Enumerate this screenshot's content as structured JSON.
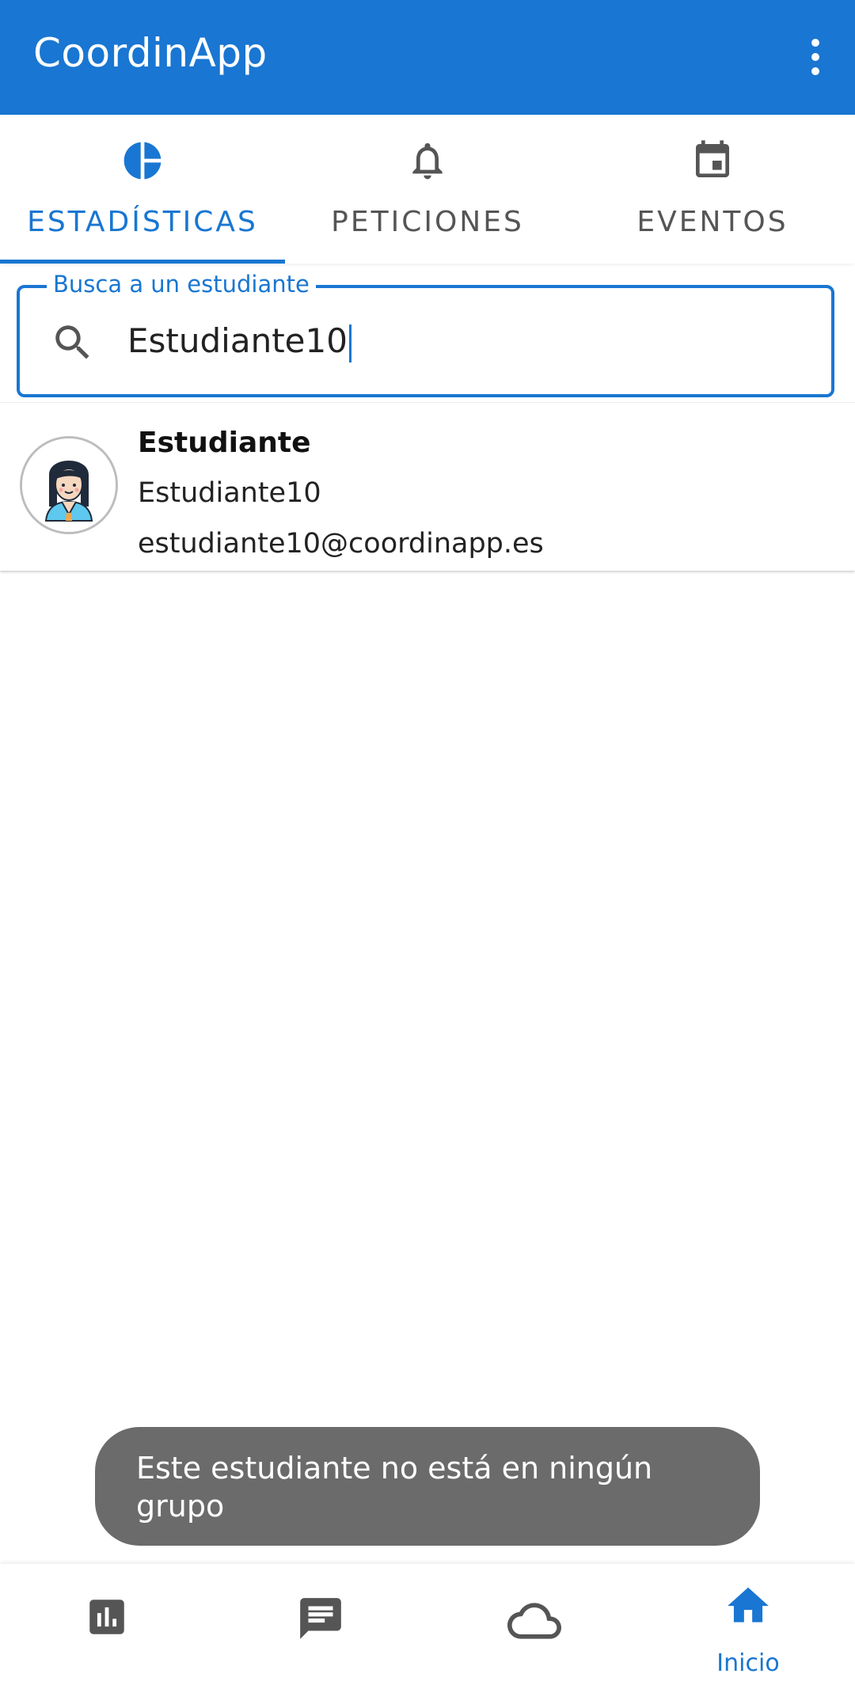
{
  "appbar": {
    "title": "CoordinApp",
    "menu_icon": "more-vert-icon"
  },
  "tabs": [
    {
      "label": "ESTADÍSTICAS",
      "icon": "pie-chart-icon",
      "active": true
    },
    {
      "label": "PETICIONES",
      "icon": "bell-icon",
      "active": false
    },
    {
      "label": "EVENTOS",
      "icon": "calendar-icon",
      "active": false
    }
  ],
  "search": {
    "label": "Busca a un estudiante",
    "value": "Estudiante10",
    "icon": "search-icon"
  },
  "results": [
    {
      "role": "Estudiante",
      "username": "Estudiante10",
      "email": "estudiante10@coordinapp.es",
      "avatar": "student-avatar-icon"
    }
  ],
  "toast": {
    "message": "Este estudiante no está en ningún grupo"
  },
  "bottom_nav": [
    {
      "icon": "bar-chart-icon",
      "label": "",
      "active": false
    },
    {
      "icon": "chat-icon",
      "label": "",
      "active": false
    },
    {
      "icon": "cloud-icon",
      "label": "",
      "active": false
    },
    {
      "icon": "home-icon",
      "label": "Inicio",
      "active": true
    }
  ],
  "colors": {
    "primary": "#1976d2",
    "icon_gray": "#555555",
    "toast_bg": "#6b6b6b"
  }
}
